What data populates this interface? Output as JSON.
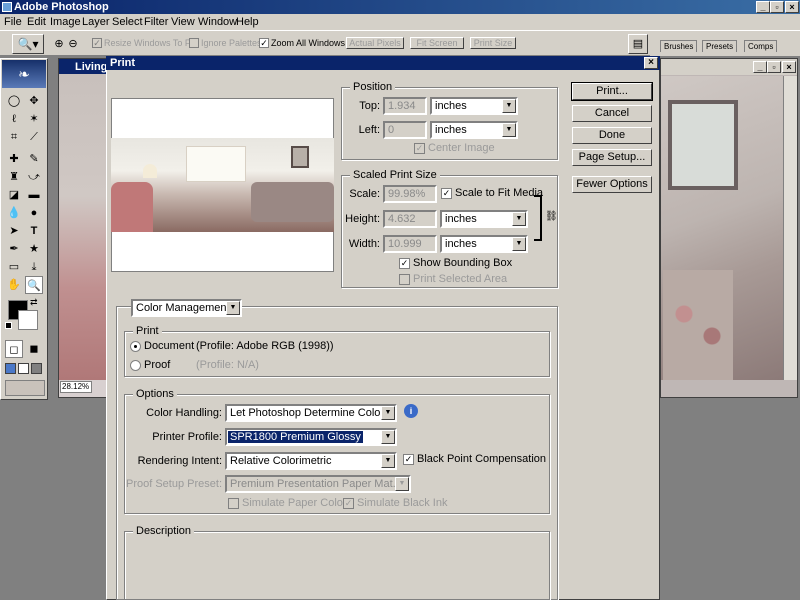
{
  "app": {
    "title": "Adobe Photoshop"
  },
  "menu": [
    "File",
    "Edit",
    "Image",
    "Layer",
    "Select",
    "Filter",
    "View",
    "Window",
    "Help"
  ],
  "options_bar": {
    "resize_windows": "Resize Windows To Fit",
    "ignore_palettes": "Ignore Palettes",
    "zoom_all_windows": "Zoom All Windows",
    "actual_pixels": "Actual Pixels",
    "fit_screen": "Fit Screen",
    "print_size": "Print Size"
  },
  "palette_tabs": [
    "Brushes",
    "Presets",
    "Comps"
  ],
  "document": {
    "title": "Living",
    "zoom": "28.12%"
  },
  "dialog": {
    "title": "Print",
    "position": {
      "label": "Position",
      "top_label": "Top:",
      "top_value": "1.934",
      "top_unit": "inches",
      "left_label": "Left:",
      "left_value": "0",
      "left_unit": "inches",
      "center_image": "Center Image"
    },
    "scaled": {
      "label": "Scaled Print Size",
      "scale_label": "Scale:",
      "scale_value": "99.98%",
      "scale_to_fit": "Scale to Fit Media",
      "height_label": "Height:",
      "height_value": "4.632",
      "height_unit": "inches",
      "width_label": "Width:",
      "width_value": "10.999",
      "width_unit": "inches",
      "show_bbox": "Show Bounding Box",
      "print_selected": "Print Selected Area"
    },
    "buttons": {
      "print": "Print...",
      "cancel": "Cancel",
      "done": "Done",
      "page_setup": "Page Setup...",
      "fewer_options": "Fewer Options"
    },
    "color_mgmt": {
      "dropdown": "Color Management",
      "print_group": "Print",
      "document_label": "Document",
      "document_profile": "(Profile: Adobe RGB (1998))",
      "proof_label": "Proof",
      "proof_profile": "(Profile: N/A)",
      "options_group": "Options",
      "color_handling_label": "Color Handling:",
      "color_handling_value": "Let Photoshop Determine Colors",
      "printer_profile_label": "Printer Profile:",
      "printer_profile_value": "SPR1800 Premium Glossy",
      "rendering_intent_label": "Rendering Intent:",
      "rendering_intent_value": "Relative Colorimetric",
      "black_point": "Black Point Compensation",
      "proof_setup_label": "Proof Setup Preset:",
      "proof_setup_value": "Premium Presentation Paper Mat...",
      "simulate_paper": "Simulate Paper Color",
      "simulate_ink": "Simulate Black Ink",
      "description_group": "Description"
    }
  }
}
